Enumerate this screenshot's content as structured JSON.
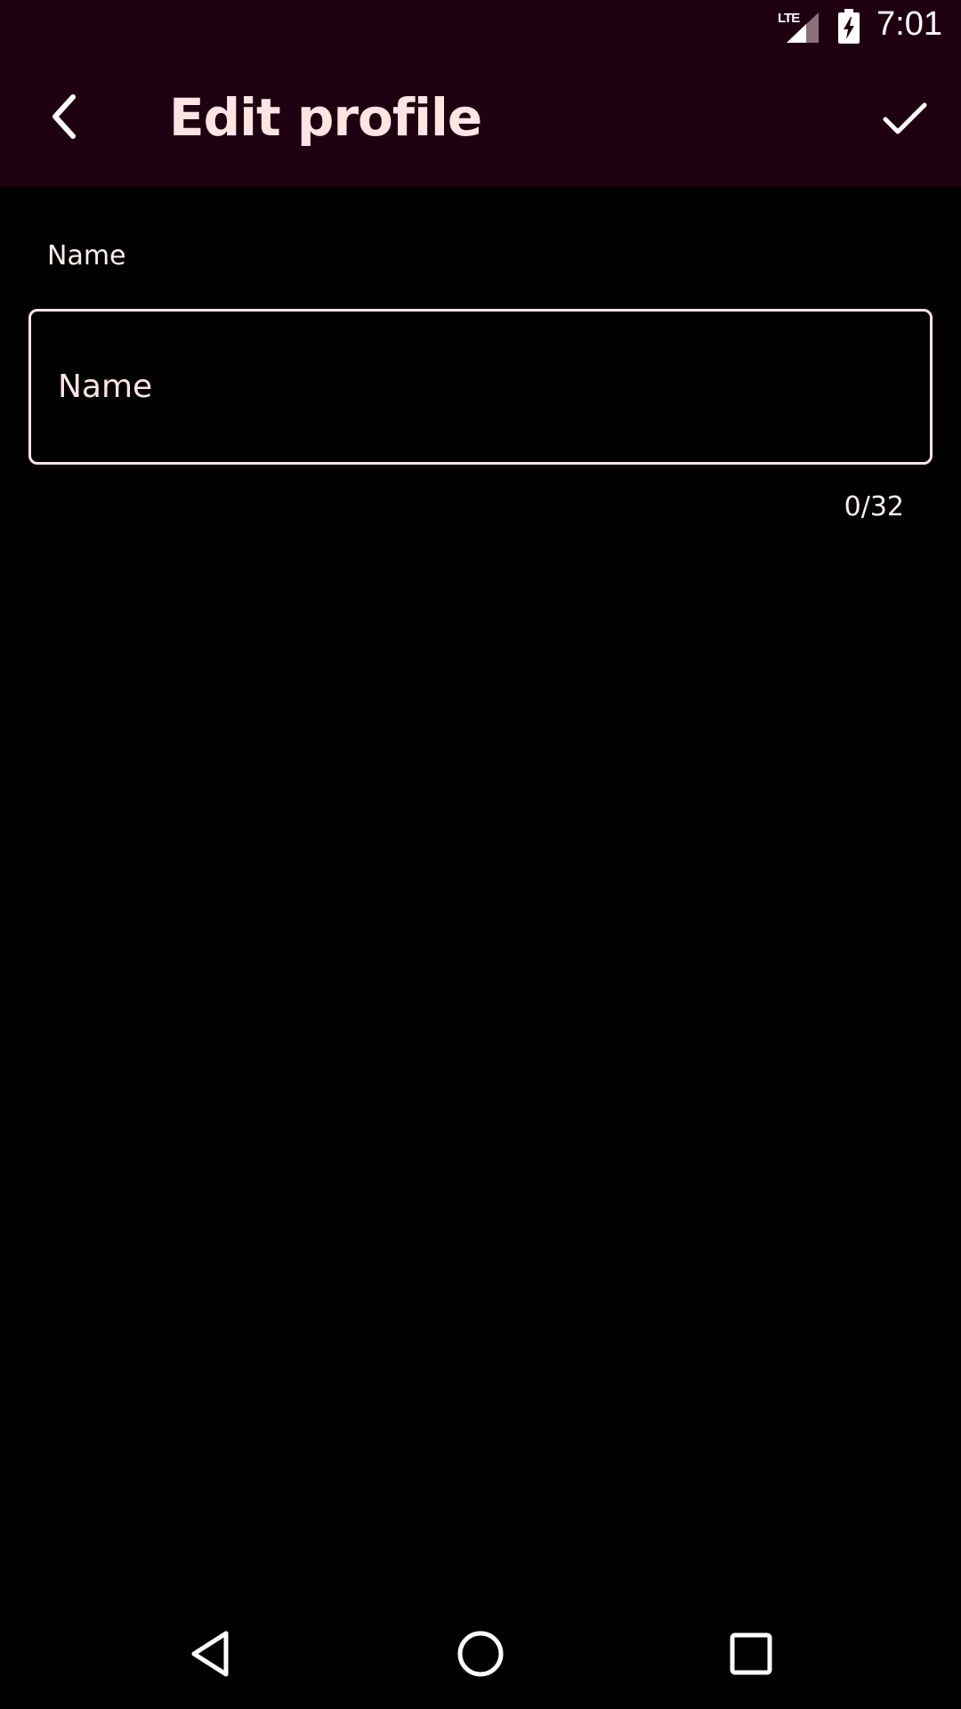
{
  "status_bar": {
    "network": "LTE",
    "time": "7:01",
    "icons": [
      "lte-signal-icon",
      "battery-charging-icon"
    ]
  },
  "app_bar": {
    "title": "Edit profile",
    "back_icon": "chevron-left-icon",
    "save_icon": "check-icon"
  },
  "form": {
    "name_label": "Name",
    "name_value": "",
    "name_placeholder": "Name",
    "counter": "0/32"
  },
  "nav_bar": {
    "icons": [
      "back-triangle-icon",
      "home-circle-icon",
      "recents-square-icon"
    ]
  },
  "colors": {
    "app_bar_bg": "#1f0010",
    "title_color": "#ffe4e4",
    "background": "#000000",
    "input_border": "#ffe4e4"
  }
}
